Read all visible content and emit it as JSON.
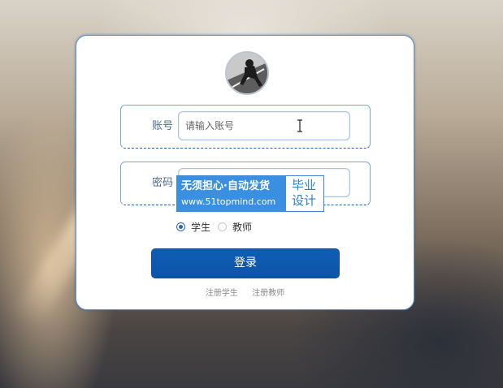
{
  "form": {
    "account": {
      "label": "账号",
      "placeholder": "请输入账号",
      "value": ""
    },
    "password": {
      "label": "密码",
      "value": ""
    },
    "roles": [
      {
        "label": "学生",
        "checked": true
      },
      {
        "label": "教师",
        "checked": false
      }
    ],
    "login_label": "登录",
    "links": {
      "register_student": "注册学生",
      "register_teacher": "注册教师"
    }
  },
  "watermark": {
    "line1": "无须担心·自动发货",
    "line2": "www.51topmind.com",
    "badge_line1": "毕业",
    "badge_line2": "设计"
  },
  "colors": {
    "accent": "#0c56aa",
    "border": "#7ba7d4",
    "watermark": "#3b8fe0"
  },
  "icons": {
    "avatar": "avatar-image",
    "cursor": "text-cursor-icon"
  }
}
